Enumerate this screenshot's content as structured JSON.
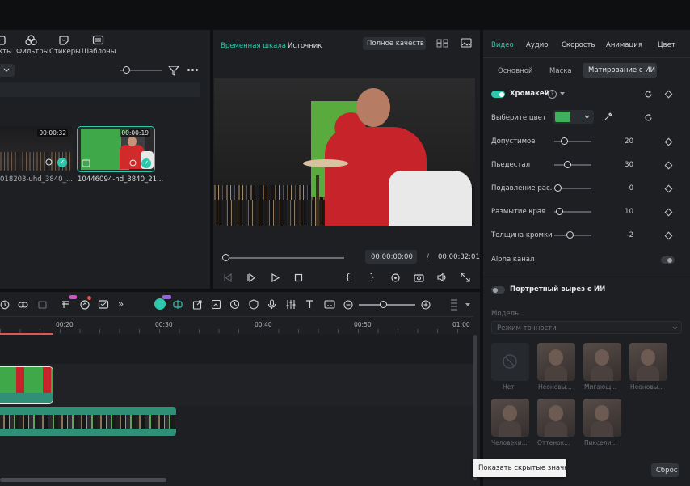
{
  "toolbar": {
    "items": [
      {
        "label": "кты",
        "icon": "effects-icon"
      },
      {
        "label": "Фильтры",
        "icon": "filters-icon"
      },
      {
        "label": "Стикеры",
        "icon": "stickers-icon"
      },
      {
        "label": "Шаблоны",
        "icon": "templates-icon"
      }
    ]
  },
  "media": {
    "clips": [
      {
        "duration": "00:00:32",
        "name": "018203-uhd_3840_..."
      },
      {
        "duration": "00:00:19",
        "name": "10446094-hd_3840_21..."
      }
    ]
  },
  "player": {
    "tabs": [
      "Временная шкала",
      "Источник"
    ],
    "quality": "Полное качеств",
    "current_time": "00:00:00:00",
    "separator": "/",
    "total_time": "00:00:32:01"
  },
  "inspector": {
    "tabs": [
      "Видео",
      "Аудио",
      "Скорость",
      "Анимация",
      "Цвет"
    ],
    "subtabs": [
      "Основной",
      "Маска",
      "Матирование с ИИ"
    ],
    "chroma_title": "Хромакей",
    "pick_color_label": "Выберите цвет",
    "key_color": "#3fb05c",
    "params": [
      {
        "label": "Допустимое",
        "value": "20"
      },
      {
        "label": "Пьедестал",
        "value": "30"
      },
      {
        "label": "Подавление рас...",
        "value": "0"
      },
      {
        "label": "Размытие края",
        "value": "10"
      },
      {
        "label": "Толщина кромки",
        "value": "-2"
      }
    ],
    "alpha_label": "Alpha канал",
    "portrait_title": "Портретный вырез с ИИ",
    "model_label": "Модель",
    "model_value": "Режим точности",
    "presets": [
      "Нет",
      "Неоновы...",
      "Мигающ...",
      "Неоновы...",
      "Человеки...",
      "Оттенок...",
      "Пиксели..."
    ],
    "reset_label": "Сброс"
  },
  "timeline": {
    "ruler": [
      "00:20",
      "00:30",
      "00:40",
      "00:50",
      "01:00"
    ]
  },
  "tooltip": "Показать скрытые значки",
  "colors": {
    "accent": "#2fc7ab",
    "panel": "#1d1f23",
    "background": "#0f1012"
  }
}
